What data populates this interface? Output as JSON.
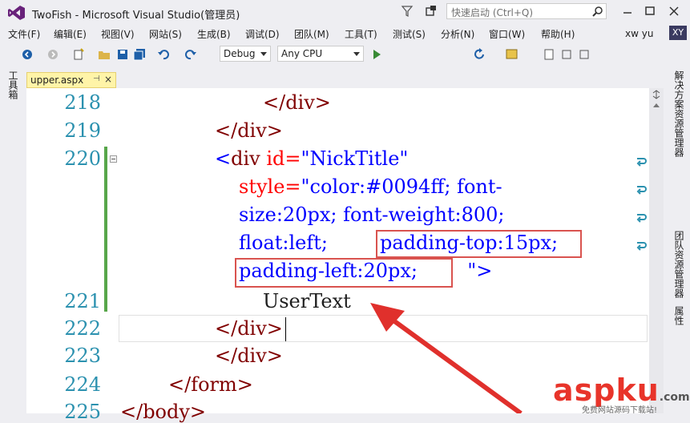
{
  "window": {
    "title": "TwoFish - Microsoft Visual Studio(管理员)",
    "quick_launch_placeholder": "快速启动 (Ctrl+Q)"
  },
  "menu": [
    {
      "label": "文件(F)"
    },
    {
      "label": "编辑(E)"
    },
    {
      "label": "视图(V)"
    },
    {
      "label": "网站(S)"
    },
    {
      "label": "生成(B)"
    },
    {
      "label": "调试(D)"
    },
    {
      "label": "团队(M)"
    },
    {
      "label": "工具(T)"
    },
    {
      "label": "测试(S)"
    },
    {
      "label": "分析(N)"
    },
    {
      "label": "窗口(W)"
    },
    {
      "label": "帮助(H)"
    }
  ],
  "user": {
    "name": "xw yu",
    "initials": "XY"
  },
  "toolbar": {
    "config": "Debug",
    "platform": "Any CPU"
  },
  "left_panel": {
    "label": "工具箱"
  },
  "right_panel": {
    "labels": [
      "解决方案资源管理器",
      "团队资源管理器",
      "属性"
    ]
  },
  "tab": {
    "name": "upper.aspx",
    "pin": "⊣",
    "close": "×"
  },
  "code": {
    "line_numbers": [
      "218",
      "219",
      "220",
      "221",
      "222",
      "223",
      "224",
      "225"
    ],
    "lines": [
      {
        "indent": "</div>"
      },
      {
        "indent": "</div>"
      },
      {
        "t1": "<",
        "t2": "div",
        "t3": " id=",
        "t4": "\"NickTitle\""
      },
      {
        "a1": "style=",
        "a2": "\"color:#0094ff; font-"
      },
      {
        "a1": "size:20px; font-weight:800;"
      },
      {
        "a1": "float:left; ",
        "box1": "padding-top:15px;"
      },
      {
        "box2": "padding-left:20px;",
        "tail": "  \">"
      },
      {
        "text": "UserText"
      },
      {
        "close": "</div>"
      },
      {
        "close": "</div>"
      },
      {
        "close": "</form>"
      },
      {
        "close": "</body>"
      }
    ]
  },
  "watermark": {
    "main": "aspku",
    "suffix": ".com",
    "sub": "免费网站源码下载站!"
  }
}
